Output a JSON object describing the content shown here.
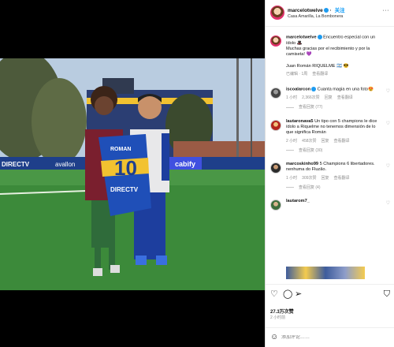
{
  "post": {
    "username": "marcelotwelve",
    "follow_label": "关注",
    "location": "Casa Amarilla, La Bombonera",
    "more": "···"
  },
  "caption": {
    "username": "marcelotwelve",
    "text_1": "Encuentro especial con un ídolo 🎩",
    "text_2": "Muchas gracias por el recibimiento y por la camiseta! 💜",
    "text_3": "Juan Román RIQUELME 🇦🇷 😎",
    "time": "已编辑 · 1周",
    "translate": "查看翻译"
  },
  "comments": [
    {
      "username": "iscoalarcon",
      "text": "Cuanta magia en una foto😍",
      "time": "1 小时",
      "likes": "2,366次赞",
      "reply": "回复",
      "translate": "查看翻译",
      "replies": "查看回复 (77)"
    },
    {
      "username": "lautaronava5",
      "text": "Un tipo con 5 champions le dice ídolo a Riquelme no tenemos dimensión de lo que significa Román",
      "time": "2 小时",
      "likes": "458次赞",
      "reply": "回复",
      "translate": "查看翻译",
      "replies": "查看回复 (30)"
    },
    {
      "username": "marcoskinho99",
      "text": "5 Champions 6 libertadores. nenhuma do Fluzão.",
      "time": "1 小时",
      "likes": "309次赞",
      "reply": "回复",
      "translate": "查看翻译",
      "replies": "查看回复 (4)"
    },
    {
      "username": "lautarom7_"
    }
  ],
  "actions": {
    "like_icon": "heart-icon",
    "comment_icon": "comment-icon",
    "share_icon": "share-icon",
    "save_icon": "bookmark-icon",
    "likes": "27.3万次赞",
    "posted": "2 小时前"
  },
  "comment_input": {
    "placeholder": "添加评论……"
  },
  "photo": {
    "jersey_name": "ROMAN",
    "jersey_number": "10",
    "sponsor": "DIRECTV",
    "board_1": "DIRECTV",
    "board_2": "avallon",
    "board_3": "cabify"
  }
}
